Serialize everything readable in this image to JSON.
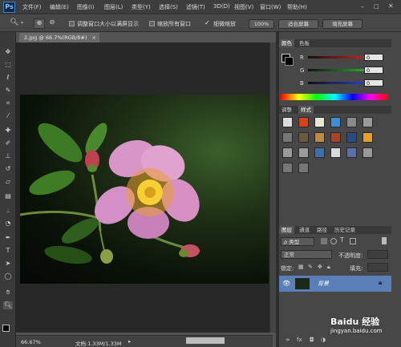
{
  "app": {
    "logo": "Ps"
  },
  "menu": [
    "文件(F)",
    "编辑(E)",
    "图像(I)",
    "图层(L)",
    "类型(Y)",
    "选择(S)",
    "滤镜(T)",
    "3D(D)",
    "视图(V)",
    "窗口(W)",
    "帮助(H)"
  ],
  "options": {
    "resize_windows": "调整窗口大小以满屏显示",
    "zoom_all": "缩放所有窗口",
    "scrubby_zoom": "细微缩放",
    "btn_100": "100%",
    "btn_fit": "适合屏幕",
    "btn_fill": "填充屏幕"
  },
  "document": {
    "tab_title": "2.jpg @ 66.7%(RGB/8#)"
  },
  "status": {
    "zoom": "66.67%",
    "doc_info": "文档:1.33M/1.33M"
  },
  "color_panel": {
    "tabs": [
      "颜色",
      "色板"
    ],
    "labels": [
      "R",
      "G",
      "B"
    ],
    "values": [
      "0",
      "0",
      "0"
    ],
    "colors": {
      "r": "#cc2222",
      "g": "#22aa33",
      "b": "#2233cc"
    }
  },
  "styles_panel": {
    "tabs": [
      "调整",
      "样式"
    ],
    "swatches": [
      "#dddddd",
      "#e04010",
      "#e8e8d0",
      "#3b8fe0",
      "#8a8a8a",
      "#9a9a9a",
      "#777777",
      "#6a5a40",
      "#c08a40",
      "#b04020",
      "#2a4a8a",
      "#e8a020",
      "#9a9a9a",
      "#9a9a9a",
      "#3b6fb0",
      "#dadada",
      "#5a6fb0",
      "#999999",
      "#777777",
      "#777777"
    ]
  },
  "layers_panel": {
    "tabs": [
      "图层",
      "通道",
      "路径",
      "历史记录"
    ],
    "filter": "ρ 类型",
    "blend_mode": "正常",
    "opacity_label": "不透明度:",
    "lock_label": "锁定:",
    "fill_label": "填充:",
    "layer_name": "背景"
  },
  "watermark": {
    "text": "Baidu 经验",
    "url": "jingyan.baidu.com"
  }
}
